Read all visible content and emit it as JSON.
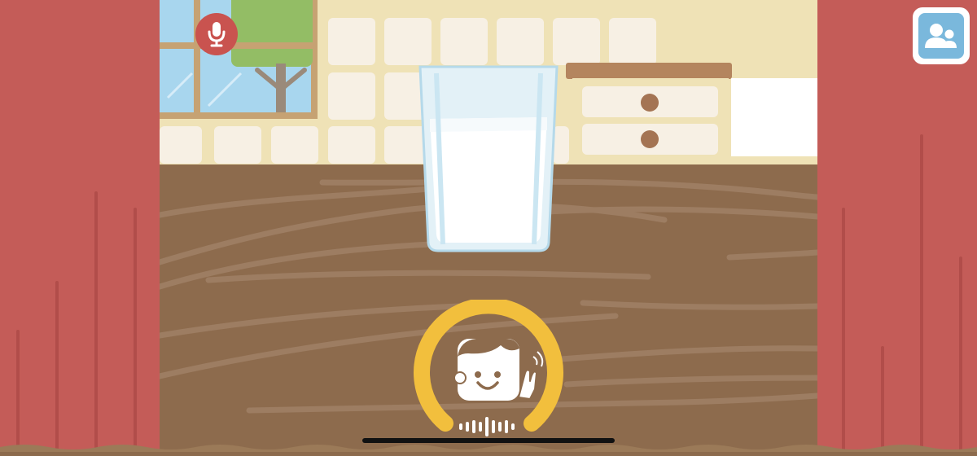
{
  "colors": {
    "curtain": "#c45c58",
    "wall": "#efe2b6",
    "table": "#8d6b4d",
    "accent_ring": "#f2bf3d",
    "profile_button": "#7ab8dc",
    "mic_button": "#c9534f"
  },
  "icons": {
    "mic": "microphone-icon",
    "profile": "profile-switch-icon",
    "listen": "listening-face-icon",
    "sound": "sound-wave-icon"
  },
  "scene": {
    "object": "glass-of-milk"
  }
}
